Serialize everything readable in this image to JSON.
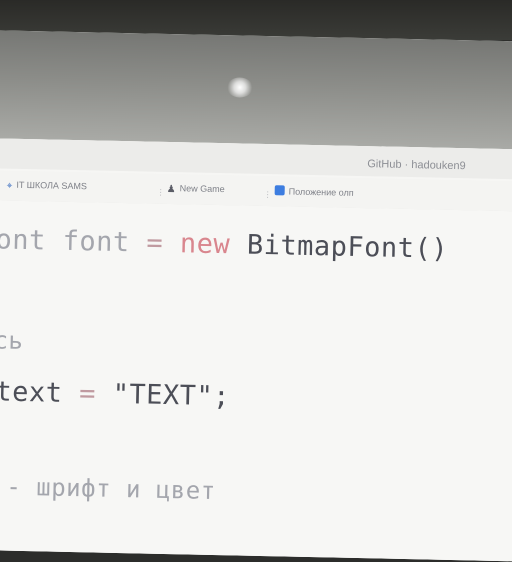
{
  "browser": {
    "github_tab": "GitHub · hadouken9",
    "bookmarks": [
      {
        "icon": "location-pin-icon",
        "label": "IT ШКОЛА SAMS"
      },
      {
        "icon": "game-figure-icon",
        "label": "New Game"
      },
      {
        "icon": "document-icon",
        "label": "Положение олп"
      }
    ]
  },
  "code": {
    "line1": {
      "type_fragment": "ont",
      "var_name": "font",
      "op": "=",
      "keyword": "new",
      "ctor": "BitmapFont()"
    },
    "line2": {
      "comment_fragment": "сь"
    },
    "line3": {
      "var_name": "text",
      "op": "=",
      "value": "\"TEXT\";"
    },
    "line4": {
      "comment": "- шрифт и цвет"
    }
  }
}
